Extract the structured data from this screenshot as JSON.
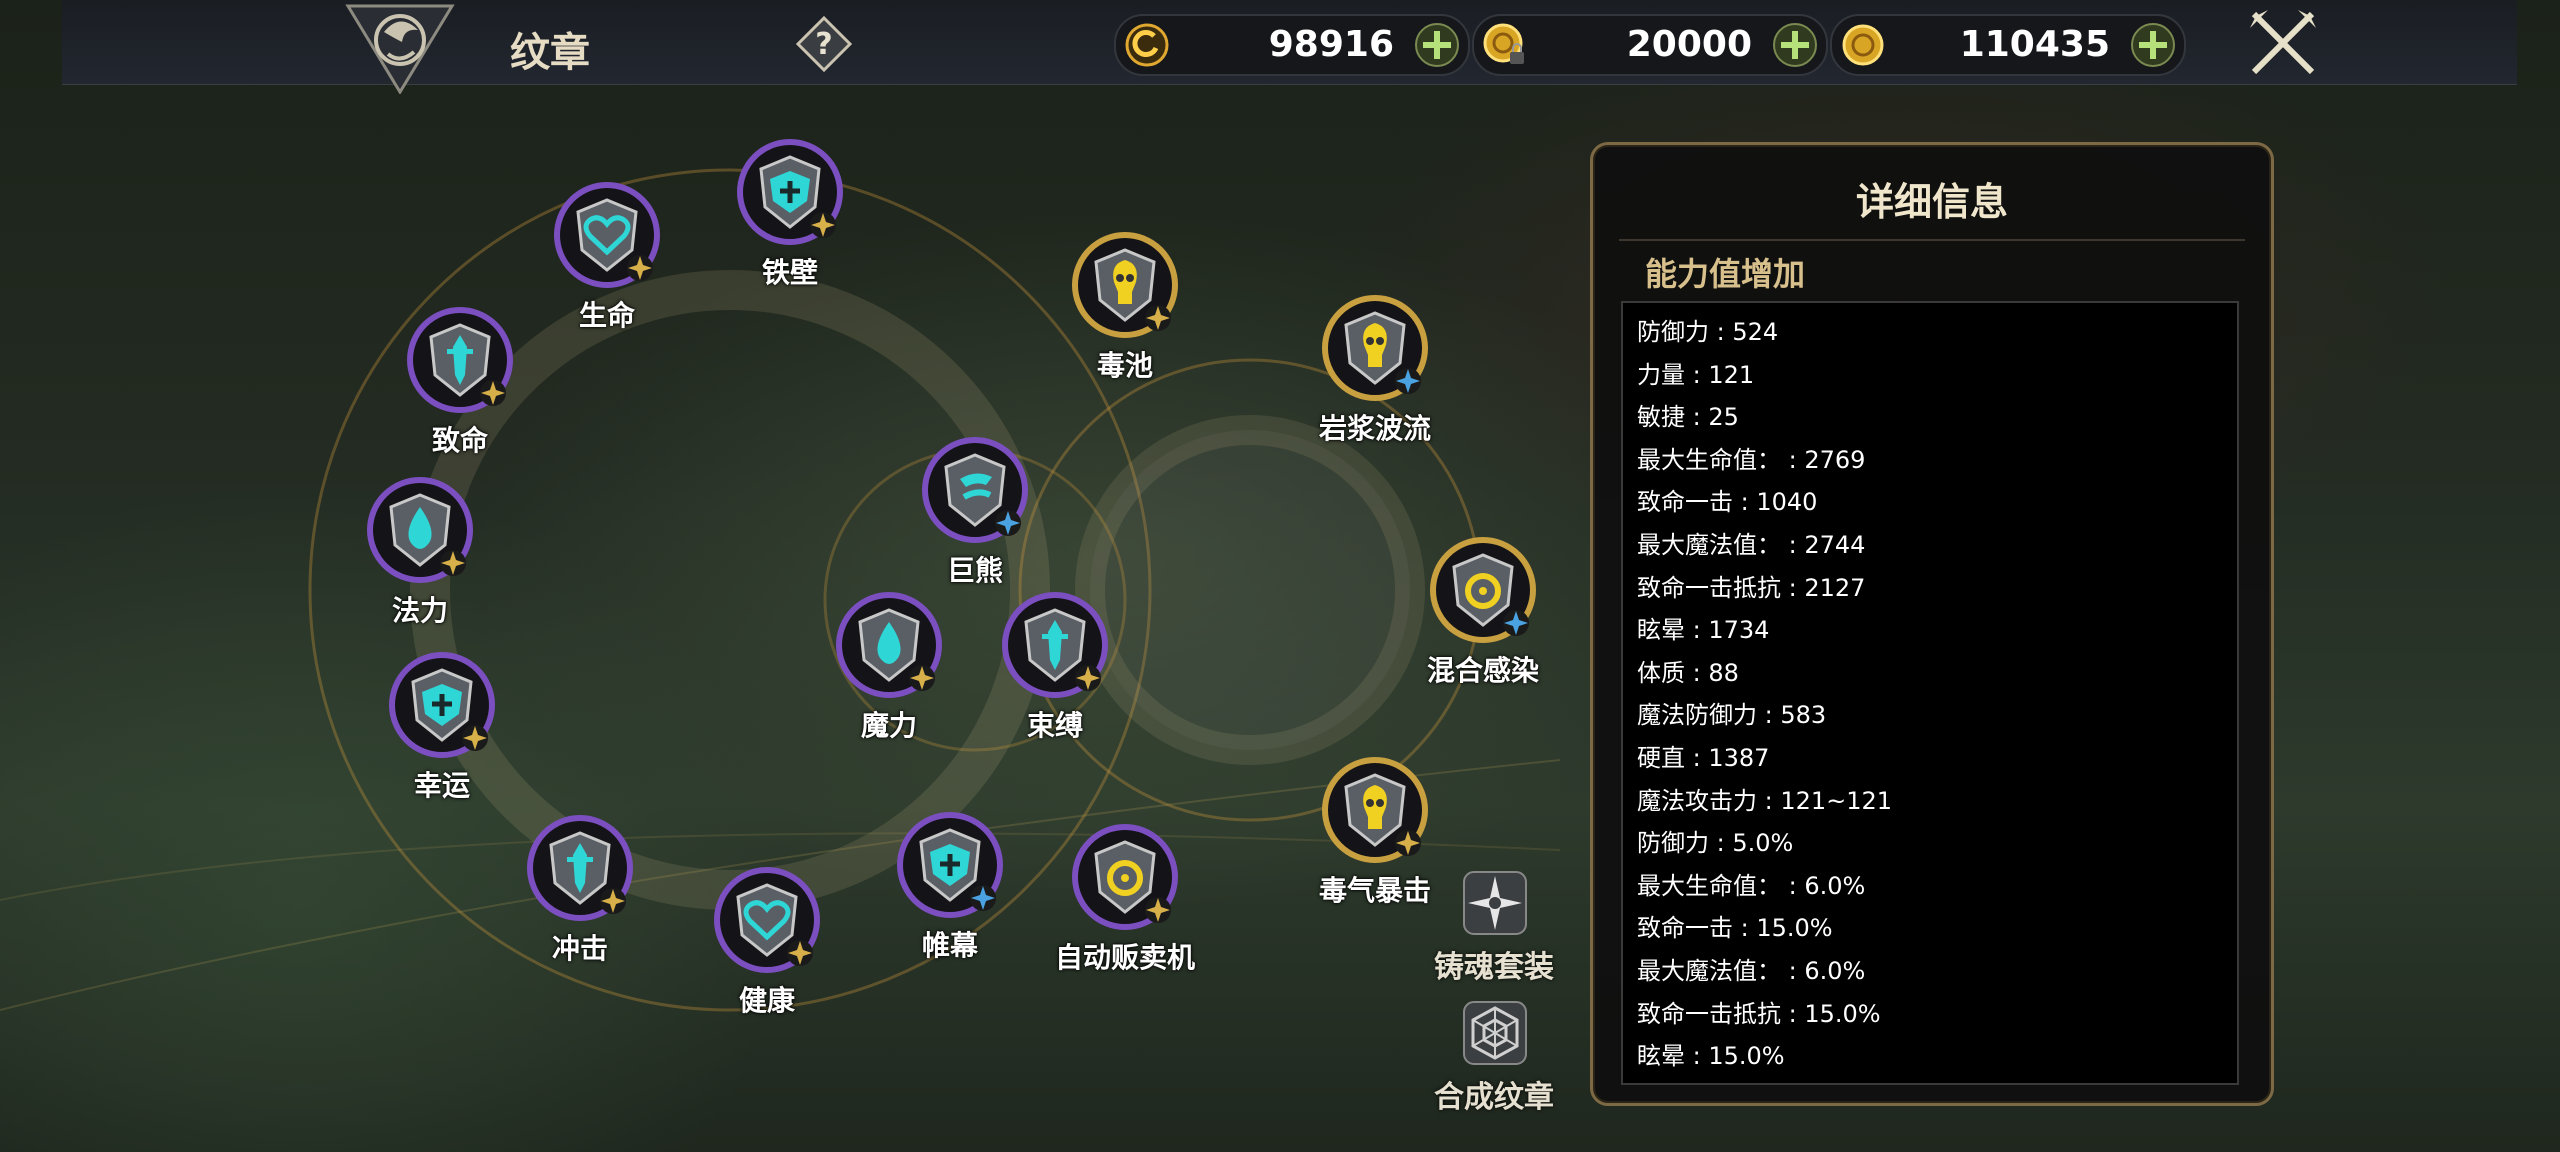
{
  "topbar": {
    "title": "纹章",
    "help_icon": "question-icon",
    "currencies": [
      {
        "name": "soul-currency",
        "icon": "swirl-coin-icon",
        "amount": "98916"
      },
      {
        "name": "locked-gold",
        "icon": "locked-gold-coin-icon",
        "amount": "20000"
      },
      {
        "name": "gold",
        "icon": "gold-coin-icon",
        "amount": "110435"
      }
    ],
    "close_icon": "crossed-swords-close-icon"
  },
  "emblems": [
    {
      "label": "铁壁",
      "tier": "purple",
      "glyph": "shield-cross",
      "badge": "gold"
    },
    {
      "label": "生命",
      "tier": "purple",
      "glyph": "heart",
      "badge": "gold"
    },
    {
      "label": "致命",
      "tier": "purple",
      "glyph": "dagger",
      "badge": "gold"
    },
    {
      "label": "法力",
      "tier": "purple",
      "glyph": "drop",
      "badge": "gold"
    },
    {
      "label": "幸运",
      "tier": "purple",
      "glyph": "shield-cross",
      "badge": "gold"
    },
    {
      "label": "冲击",
      "tier": "purple",
      "glyph": "dagger",
      "badge": "gold"
    },
    {
      "label": "健康",
      "tier": "purple",
      "glyph": "heart",
      "badge": "gold"
    },
    {
      "label": "帷幕",
      "tier": "purple",
      "glyph": "shield-cross",
      "badge": "blue"
    },
    {
      "label": "自动贩卖机",
      "tier": "purple",
      "glyph": "yellow-ring",
      "badge": "gold"
    },
    {
      "label": "毒气暴击",
      "tier": "gold",
      "glyph": "yellow-skull",
      "badge": "gold"
    },
    {
      "label": "混合感染",
      "tier": "gold",
      "glyph": "yellow-ring",
      "badge": "blue"
    },
    {
      "label": "岩浆波流",
      "tier": "gold",
      "glyph": "yellow-skull",
      "badge": "blue"
    },
    {
      "label": "毒池",
      "tier": "gold",
      "glyph": "yellow-skull",
      "badge": "gold"
    },
    {
      "label": "巨熊",
      "tier": "purple",
      "glyph": "claw",
      "badge": "blue"
    },
    {
      "label": "魔力",
      "tier": "purple",
      "glyph": "drop",
      "badge": "gold"
    },
    {
      "label": "束缚",
      "tier": "purple",
      "glyph": "dagger",
      "badge": "gold"
    }
  ],
  "side_buttons": {
    "soul_set": {
      "label": "铸魂套装",
      "icon": "compass-star-icon"
    },
    "combine": {
      "label": "合成纹章",
      "icon": "web-emblem-icon"
    }
  },
  "panel": {
    "title": "详细信息",
    "subtitle": "能力值增加",
    "stats": [
      "防御力 : 524",
      "力量 : 121",
      "敏捷 : 25",
      "最大生命值： : 2769",
      "致命一击 : 1040",
      "最大魔法值： : 2744",
      "致命一击抵抗 : 2127",
      "眩晕 : 1734",
      "体质 : 88",
      "魔法防御力 : 583",
      "硬直 : 1387",
      "魔法攻击力 : 121~121",
      "防御力 : 5.0%",
      "最大生命值： : 6.0%",
      "致命一击 : 15.0%",
      "最大魔法值： : 6.0%",
      "致命一击抵抗 : 15.0%",
      "眩晕 : 15.0%"
    ]
  },
  "colors": {
    "purple_ring": "#7b4fc0",
    "gold_ring": "#c8a040",
    "cyan_glyph": "#2fd6d6",
    "yellow_glyph": "#f0d020",
    "panel_border": "#7d6a45"
  }
}
